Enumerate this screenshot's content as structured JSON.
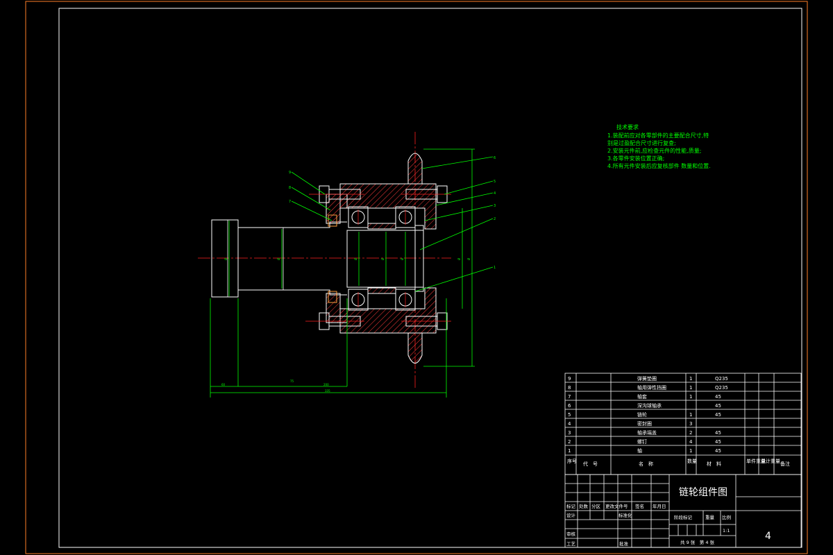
{
  "colors": {
    "background": "#000000",
    "border_outer": "#ff7f27",
    "frame": "#ffffff",
    "part_outline": "#ffffff",
    "hatch": "#ff3b3b",
    "centerline": "#ff2020",
    "dimension": "#00ff00",
    "notes": "#00ff00",
    "table": "#ffffff"
  },
  "tech_notes": {
    "title": "技术要求",
    "lines": [
      "1.装配前应对各零部件的主要配合尺寸,特",
      "  别是过盈配合尺寸进行复查;",
      "2.安装元件前,应检查元件的性能,质量;",
      "3.各零件安装位置正确;",
      "4.所有元件安装后应复核部件 数量和位置."
    ]
  },
  "dimensions": {
    "d_left": "Ø",
    "d_shaft": "Ø",
    "d_bore1": "Ø",
    "d_bore2": "Ø",
    "d_bore3": "Ø",
    "h_overall": "Ø",
    "h_inner": "Ø",
    "l_first": "60",
    "l_second": "75",
    "l_third": "200",
    "l_total": "335"
  },
  "balloons": [
    "9",
    "8",
    "7",
    "6",
    "5",
    "4",
    "3",
    "2",
    "1"
  ],
  "parts": [
    {
      "no": "9",
      "name": "弹簧垫圈",
      "qty": "1",
      "material": "Q235"
    },
    {
      "no": "8",
      "name": "轴用弹性挡圈",
      "qty": "1",
      "material": "Q235"
    },
    {
      "no": "7",
      "name": "轴套",
      "qty": "1",
      "material": "45"
    },
    {
      "no": "6",
      "name": "深沟球轴承",
      "qty": "",
      "material": "45"
    },
    {
      "no": "5",
      "name": "链轮",
      "qty": "1",
      "material": "45"
    },
    {
      "no": "4",
      "name": "密封圈",
      "qty": "3",
      "material": ""
    },
    {
      "no": "3",
      "name": "轴承端盖",
      "qty": "2",
      "material": "45"
    },
    {
      "no": "2",
      "name": "螺钉",
      "qty": "4",
      "material": "45"
    },
    {
      "no": "1",
      "name": "轴",
      "qty": "1",
      "material": "45"
    }
  ],
  "table_header": {
    "seq": "序号",
    "code": "代　号",
    "name": "名　称",
    "qty": "数量",
    "material": "材　料",
    "unit_weight": "单件重量",
    "total_weight": "总计重量",
    "remark": "备注"
  },
  "title_block": {
    "drawing_title": "链轮组件图",
    "marks": [
      "标记",
      "处数",
      "分区",
      "更改文件号",
      "签名",
      "年月日"
    ],
    "design": "设计",
    "standardize": "标准化",
    "review": "审核",
    "process": "工艺",
    "approve": "批准",
    "stage_mark": "阶段标记",
    "weight": "重量",
    "scale": "比例",
    "scale_value": "1:1",
    "sheets": "共 9 张　第 4 张",
    "sheet_number": "4"
  }
}
